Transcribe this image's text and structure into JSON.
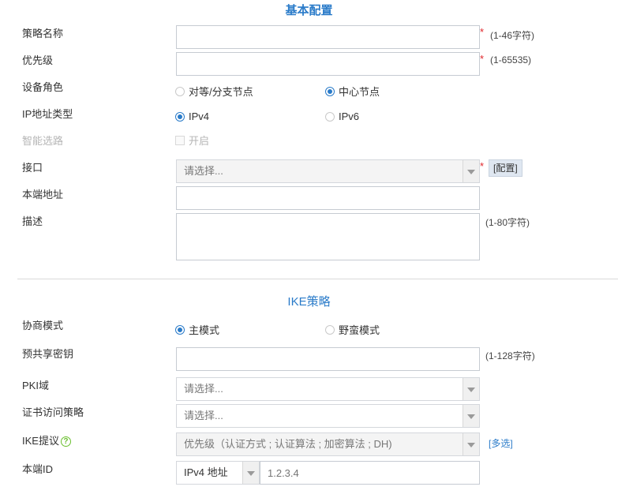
{
  "basic": {
    "title": "基本配置",
    "policy_name": {
      "label": "策略名称",
      "value": "",
      "hint": "(1-46字符)"
    },
    "priority": {
      "label": "优先级",
      "value": "",
      "hint": "(1-65535)"
    },
    "device_role": {
      "label": "设备角色",
      "options": [
        "对等/分支节点",
        "中心节点"
      ],
      "selected": "中心节点"
    },
    "ip_type": {
      "label": "IP地址类型",
      "options": [
        "IPv4",
        "IPv6"
      ],
      "selected": "IPv4"
    },
    "smart_route": {
      "label": "智能选路",
      "checkbox_label": "开启",
      "checked": false
    },
    "interface": {
      "label": "接口",
      "placeholder": "请选择...",
      "config_button": "[配置]"
    },
    "local_address": {
      "label": "本端地址",
      "value": ""
    },
    "description": {
      "label": "描述",
      "value": "",
      "hint": "(1-80字符)"
    },
    "required_mark": "*"
  },
  "ike": {
    "title": "IKE策略",
    "negotiation_mode": {
      "label": "协商模式",
      "options": [
        "主模式",
        "野蛮模式"
      ],
      "selected": "主模式"
    },
    "psk": {
      "label": "预共享密钥",
      "value": "",
      "hint": "(1-128字符)"
    },
    "pki_domain": {
      "label": "PKI域",
      "placeholder": "请选择..."
    },
    "cert_policy": {
      "label": "证书访问策略",
      "placeholder": "请选择..."
    },
    "ike_proposal": {
      "label": "IKE提议",
      "help_icon": "?",
      "placeholder": "优先级（认证方式 ; 认证算法 ; 加密算法 ; DH)",
      "multi_link": "[多选]"
    },
    "local_id": {
      "label": "本端ID",
      "type_selected": "IPv4 地址",
      "placeholder": "1.2.3.4"
    }
  },
  "colors": {
    "accent": "#2a7bc9",
    "required": "#e0262b",
    "help": "#6abf2e"
  },
  "icons": [
    "chevron-down-icon",
    "radio-icon",
    "checkbox-icon",
    "help-icon"
  ]
}
